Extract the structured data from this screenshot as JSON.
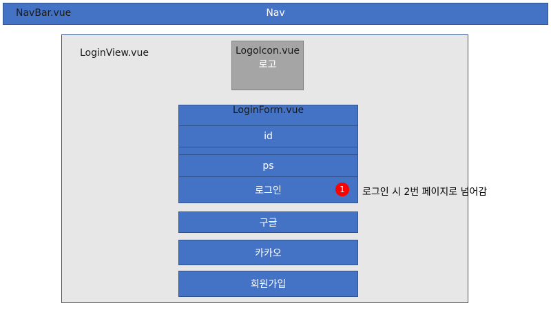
{
  "navbar": {
    "file": "NavBar.vue",
    "title": "Nav"
  },
  "login_view": {
    "file": "LoginView.vue"
  },
  "logo_icon": {
    "file": "LogoIcon.vue",
    "name": "로고"
  },
  "login_form": {
    "file": "LoginForm.vue",
    "id_label": "id",
    "ps_label": "ps",
    "login_label": "로그인"
  },
  "buttons": {
    "google": "구글",
    "kakao": "카카오",
    "signup": "회원가입"
  },
  "annotation": {
    "number": "1",
    "text": "로그인 시 2번 페이지로 넘어감"
  },
  "colors": {
    "blue": "#4472c4",
    "border": "#2f528f",
    "gray": "#a5a5a5",
    "panel": "#e7e7e7",
    "badge": "#ff0000"
  }
}
